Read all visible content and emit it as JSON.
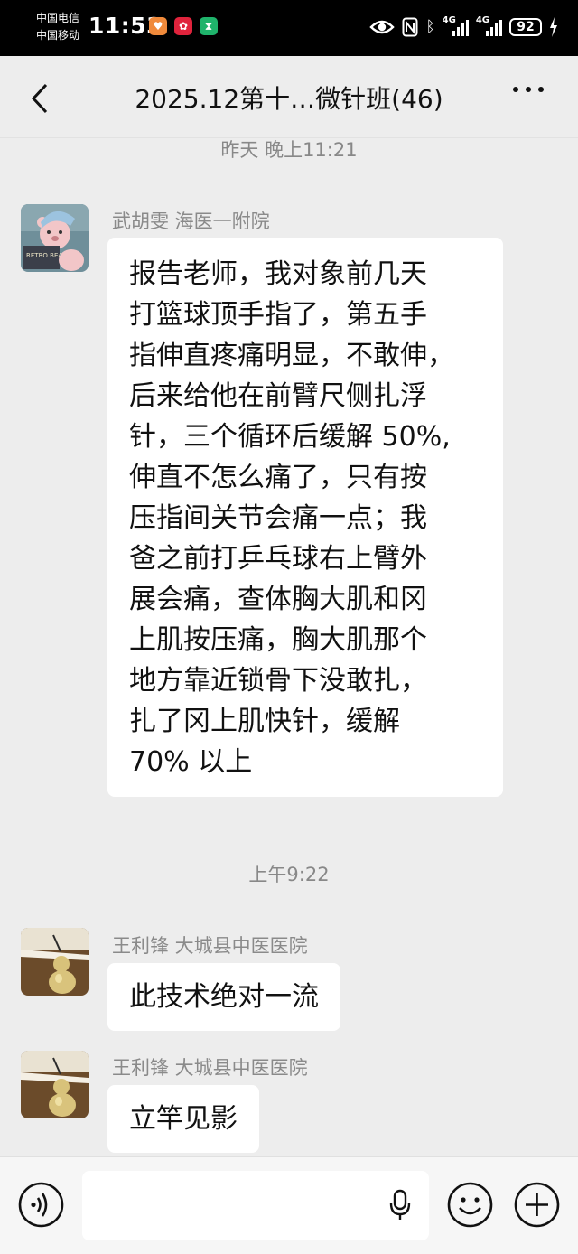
{
  "status_bar": {
    "carrier_1": "中国电信",
    "carrier_2": "中国移动",
    "time": "11:53",
    "network_1": "4G",
    "network_2": "4G",
    "battery": "92"
  },
  "header": {
    "title": "2025.12第十…微针班(46)"
  },
  "messages": [
    {
      "type": "time",
      "text": "昨天 晚上11:21"
    },
    {
      "type": "message",
      "sender": "武胡雯 海医一附院",
      "lines": [
        "报告老师，我对象前几天",
        "打篮球顶手指了，第五手",
        "指伸直疼痛明显，不敢伸，",
        "后来给他在前臂尺侧扎浮",
        "针，三个循环后缓解 50%,",
        "伸直不怎么痛了，只有按",
        "压指间关节会痛一点；我",
        "爸之前打乒乓球右上臂外",
        "展会痛，查体胸大肌和冈",
        "上肌按压痛，胸大肌那个",
        "地方靠近锁骨下没敢扎，",
        "扎了冈上肌快针，缓解",
        "70% 以上"
      ]
    },
    {
      "type": "time",
      "text": "上午9:22"
    },
    {
      "type": "message",
      "sender": "王利锋 大城县中医医院",
      "text": "此技术绝对一流"
    },
    {
      "type": "message",
      "sender": "王利锋 大城县中医医院",
      "text": "立竿见影"
    }
  ],
  "avatar_1_text": "RETRO BEAR",
  "icons": {
    "back": "back-arrow-icon",
    "more": "more-dots-icon",
    "voice": "voice-icon",
    "mic": "mic-icon",
    "emoji": "emoji-icon",
    "add": "add-icon"
  },
  "colors": {
    "status_bar": "#000000",
    "background": "#ededed",
    "bubble": "#ffffff",
    "meta_text": "#8a8a8a"
  }
}
